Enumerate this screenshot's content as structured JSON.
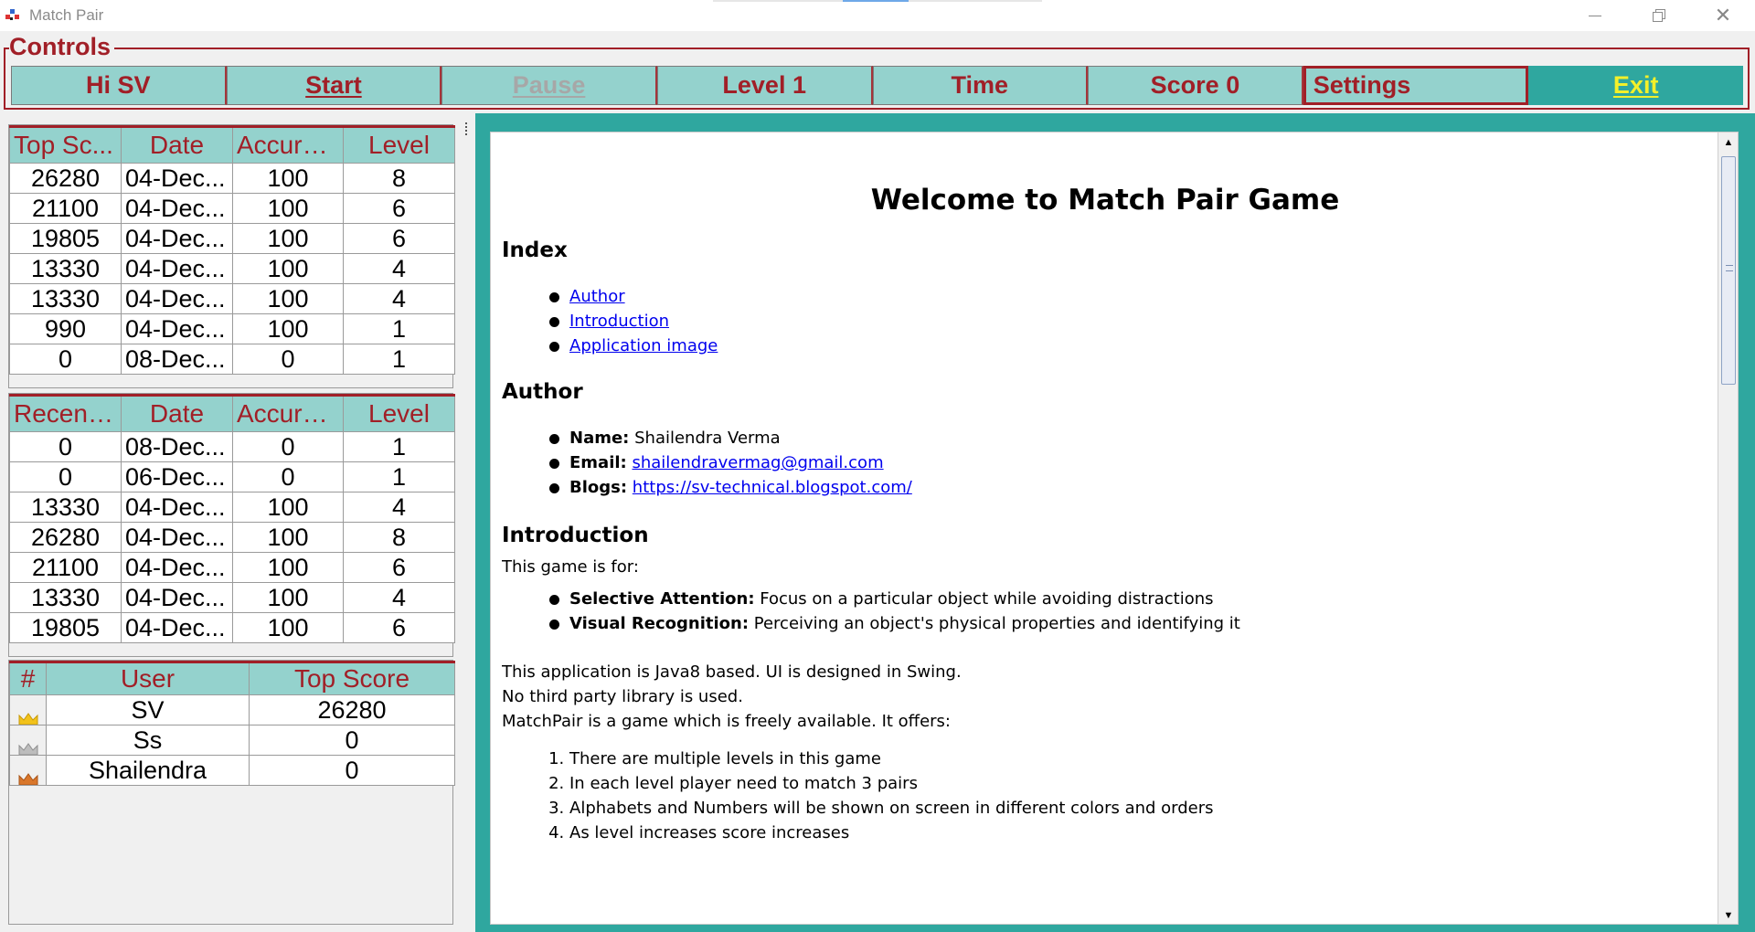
{
  "window": {
    "title": "Match Pair"
  },
  "controls": {
    "legend": "Controls",
    "buttons": {
      "greeting": "Hi SV",
      "start": "Start",
      "pause": "Pause",
      "level": "Level 1",
      "time": "Time",
      "score": "Score 0",
      "settings": "Settings",
      "exit": "Exit"
    }
  },
  "top_scores": {
    "headers": [
      "Top Sc...",
      "Date",
      "Accuracy",
      "Level"
    ],
    "rows": [
      [
        "26280",
        "04-Dec...",
        "100",
        "8"
      ],
      [
        "21100",
        "04-Dec...",
        "100",
        "6"
      ],
      [
        "19805",
        "04-Dec...",
        "100",
        "6"
      ],
      [
        "13330",
        "04-Dec...",
        "100",
        "4"
      ],
      [
        "13330",
        "04-Dec...",
        "100",
        "4"
      ],
      [
        "990",
        "04-Dec...",
        "100",
        "1"
      ],
      [
        "0",
        "08-Dec...",
        "0",
        "1"
      ]
    ]
  },
  "recent_scores": {
    "headers": [
      "Recent ...",
      "Date",
      "Accuracy",
      "Level"
    ],
    "rows": [
      [
        "0",
        "08-Dec...",
        "0",
        "1"
      ],
      [
        "0",
        "06-Dec...",
        "0",
        "1"
      ],
      [
        "13330",
        "04-Dec...",
        "100",
        "4"
      ],
      [
        "26280",
        "04-Dec...",
        "100",
        "8"
      ],
      [
        "21100",
        "04-Dec...",
        "100",
        "6"
      ],
      [
        "13330",
        "04-Dec...",
        "100",
        "4"
      ],
      [
        "19805",
        "04-Dec...",
        "100",
        "6"
      ]
    ]
  },
  "leaderboard": {
    "headers": [
      "#",
      "User",
      "Top Score"
    ],
    "rows": [
      {
        "crown": "gold-crown-icon",
        "crown_color": "#f2c21b",
        "user": "SV",
        "score": "26280"
      },
      {
        "crown": "silver-crown-icon",
        "crown_color": "#bdbdbd",
        "user": "Ss",
        "score": "0"
      },
      {
        "crown": "bronze-crown-icon",
        "crown_color": "#d9772b",
        "user": "Shailendra",
        "score": "0"
      }
    ]
  },
  "doc": {
    "title": "Welcome to Match Pair Game",
    "index_heading": "Index",
    "index_links": [
      "Author",
      "Introduction",
      "Application image"
    ],
    "author_heading": "Author",
    "author": {
      "name_label": "Name:",
      "name": "Shailendra Verma",
      "email_label": "Email:",
      "email": "shailendravermag@gmail.com",
      "blogs_label": "Blogs:",
      "blog_url": "https://sv-technical.blogspot.com/"
    },
    "intro_heading": "Introduction",
    "intro_lead": "This game is for:",
    "intro_points": [
      {
        "label": "Selective Attention:",
        "text": "Focus on a particular object while avoiding distractions"
      },
      {
        "label": "Visual Recognition:",
        "text": "Perceiving an object's physical properties and identifying it"
      }
    ],
    "paragraph_lines": [
      "This application is Java8 based. UI is designed in Swing.",
      "No third party library is used.",
      "MatchPair is a game which is freely available. It offers:"
    ],
    "offers": [
      "There are multiple levels in this game",
      "In each level player need to match 3 pairs",
      "Alphabets and Numbers will be shown on screen in different colors and orders",
      "As level increases score increases"
    ]
  },
  "colors": {
    "accent_red": "#a11f27",
    "button_teal": "#94d2cd",
    "frame_teal": "#2fa79f",
    "exit_text": "#f3f02a"
  }
}
